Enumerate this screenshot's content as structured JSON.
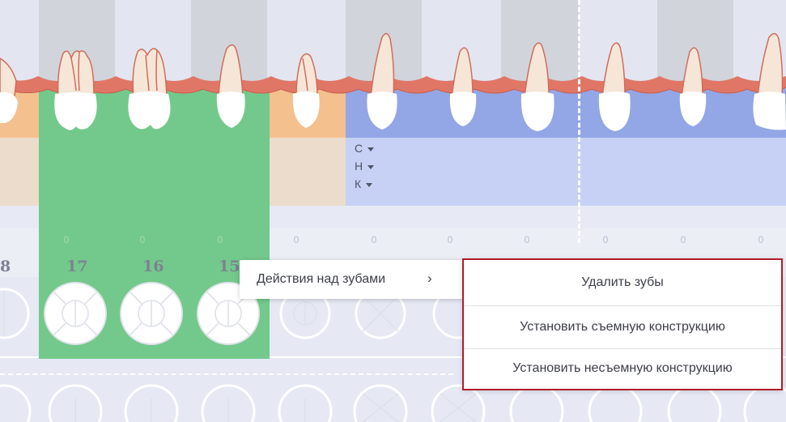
{
  "dental_chart": {
    "surfaces": [
      {
        "label": "С"
      },
      {
        "label": "Н"
      },
      {
        "label": "К"
      }
    ],
    "tooth_numbers": [
      "8",
      "17",
      "16",
      "15"
    ],
    "zero_values": [
      "0",
      "0",
      "0",
      "0",
      "0",
      "0",
      "0",
      "0",
      "0",
      "0"
    ]
  },
  "context_menu": {
    "submenu_label": "Действия над зубами",
    "submenu_chevron": "›",
    "items": [
      {
        "label": "Удалить зубы"
      },
      {
        "label": "Установить съемную конструкцию"
      },
      {
        "label": "Установить несъемную конструкцию"
      }
    ]
  },
  "colors": {
    "selection_green": "#73c98b",
    "gum": "#e07766",
    "highlight_border": "#b01c2a",
    "blue_zone": "#93a6e5",
    "orange_zone": "#f4c08e"
  }
}
